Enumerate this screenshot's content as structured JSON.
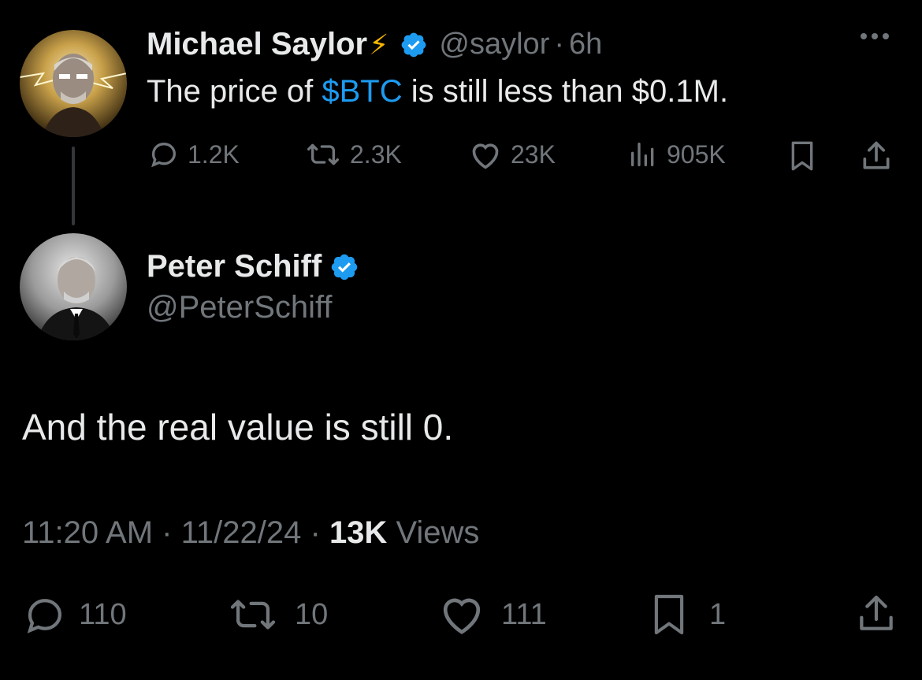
{
  "parent_tweet": {
    "display_name": "Michael Saylor",
    "name_emoji": "⚡",
    "handle": "@saylor",
    "separator": "·",
    "time": "6h",
    "text_before": "The price of ",
    "cashtag": "$BTC",
    "text_after": " is still less than $0.1M.",
    "replies": "1.2K",
    "reposts": "2.3K",
    "likes": "23K",
    "views": "905K"
  },
  "reply_tweet": {
    "display_name": "Peter Schiff",
    "handle": "@PeterSchiff",
    "text": "And the real value is still 0.",
    "time": "11:20 AM",
    "separator": "·",
    "date": "11/22/24",
    "views_count": "13K",
    "views_label": " Views",
    "replies": "110",
    "reposts": "10",
    "likes": "111",
    "bookmarks": "1"
  },
  "colors": {
    "background": "#000000",
    "primary_text": "#e7e9ea",
    "secondary_text": "#71767b",
    "accent": "#1d9bf0"
  }
}
